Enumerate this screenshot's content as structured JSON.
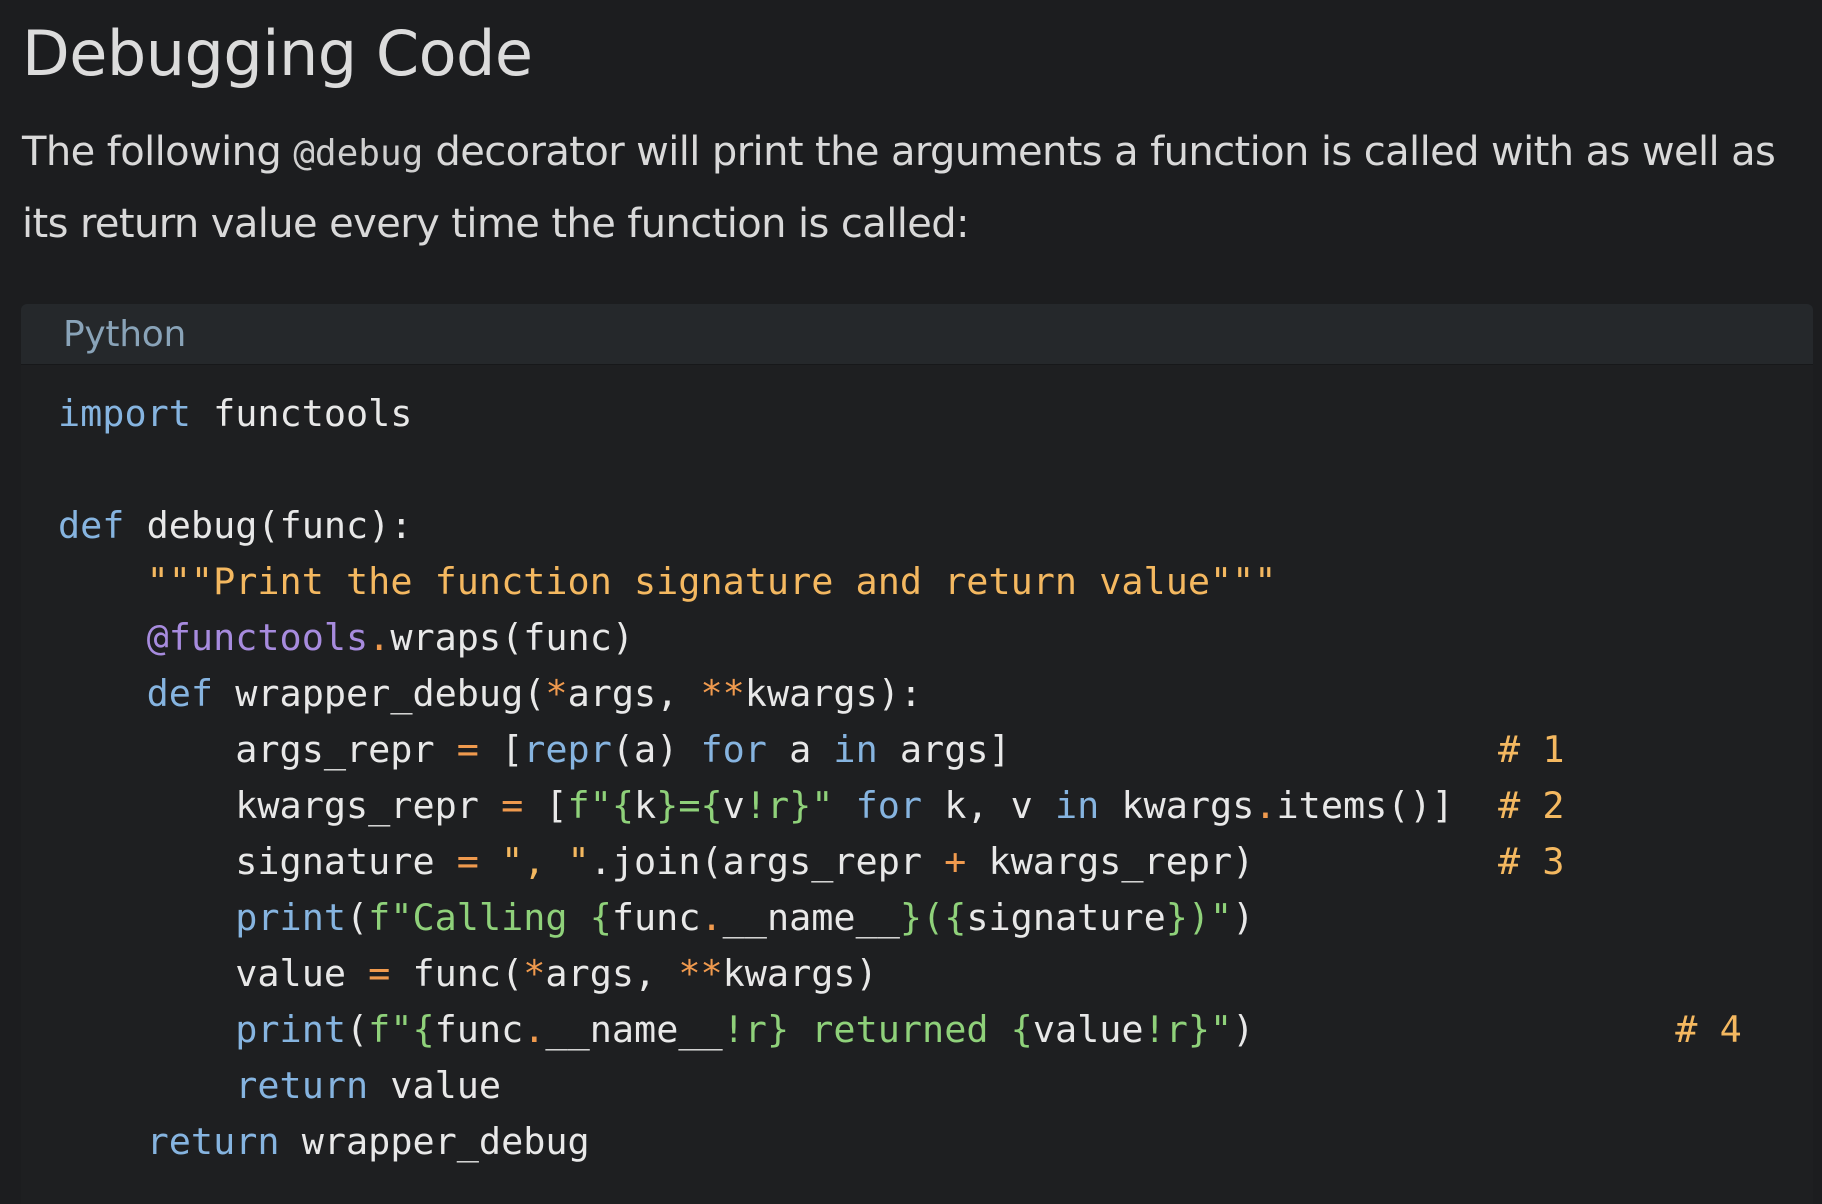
{
  "page": {
    "title": "Debugging Code",
    "intro": {
      "before": "The following ",
      "code": "@debug",
      "after": " decorator will print the arguments a function is called with as well as its return value every time the function is called:"
    }
  },
  "code_block": {
    "language": "Python",
    "lines": [
      [
        {
          "t": "import",
          "k": "kw"
        },
        {
          "t": " functools"
        }
      ],
      [],
      [
        {
          "t": "def",
          "k": "kw"
        },
        {
          "t": " debug(func):"
        }
      ],
      [
        {
          "t": "    "
        },
        {
          "t": "\"\"\"Print the function signature and return value\"\"\"",
          "k": "str"
        }
      ],
      [
        {
          "t": "    "
        },
        {
          "t": "@functools",
          "k": "dec"
        },
        {
          "t": ".",
          "k": "op"
        },
        {
          "t": "wraps(func)"
        }
      ],
      [
        {
          "t": "    "
        },
        {
          "t": "def",
          "k": "kw"
        },
        {
          "t": " wrapper_debug("
        },
        {
          "t": "*",
          "k": "op"
        },
        {
          "t": "args, "
        },
        {
          "t": "**",
          "k": "op"
        },
        {
          "t": "kwargs):"
        }
      ],
      [
        {
          "t": "        args_repr "
        },
        {
          "t": "=",
          "k": "op"
        },
        {
          "t": " ["
        },
        {
          "t": "repr",
          "k": "bi"
        },
        {
          "t": "(a) "
        },
        {
          "t": "for",
          "k": "kw"
        },
        {
          "t": " a "
        },
        {
          "t": "in",
          "k": "kw"
        },
        {
          "t": " args]                      "
        },
        {
          "t": "# 1",
          "k": "cm"
        }
      ],
      [
        {
          "t": "        kwargs_repr "
        },
        {
          "t": "=",
          "k": "op"
        },
        {
          "t": " ["
        },
        {
          "t": "f\"",
          "k": "fs"
        },
        {
          "t": "{",
          "k": "fs"
        },
        {
          "t": "k"
        },
        {
          "t": "}=",
          "k": "fs"
        },
        {
          "t": "{",
          "k": "fs"
        },
        {
          "t": "v"
        },
        {
          "t": "!r",
          "k": "fs"
        },
        {
          "t": "}\"",
          "k": "fs"
        },
        {
          "t": " "
        },
        {
          "t": "for",
          "k": "kw"
        },
        {
          "t": " k, v "
        },
        {
          "t": "in",
          "k": "kw"
        },
        {
          "t": " kwargs"
        },
        {
          "t": ".",
          "k": "op"
        },
        {
          "t": "items()]  "
        },
        {
          "t": "# 2",
          "k": "cm"
        }
      ],
      [
        {
          "t": "        signature "
        },
        {
          "t": "=",
          "k": "op"
        },
        {
          "t": " "
        },
        {
          "t": "\", \"",
          "k": "str"
        },
        {
          "t": ".join(args_repr "
        },
        {
          "t": "+",
          "k": "op"
        },
        {
          "t": " kwargs_repr)           "
        },
        {
          "t": "# 3",
          "k": "cm"
        }
      ],
      [
        {
          "t": "        "
        },
        {
          "t": "print",
          "k": "bi"
        },
        {
          "t": "("
        },
        {
          "t": "f\"Calling ",
          "k": "fs"
        },
        {
          "t": "{",
          "k": "fs"
        },
        {
          "t": "func"
        },
        {
          "t": ".",
          "k": "op"
        },
        {
          "t": "__name__"
        },
        {
          "t": "}(",
          "k": "fs"
        },
        {
          "t": "{",
          "k": "fs"
        },
        {
          "t": "signature"
        },
        {
          "t": "})\"",
          "k": "fs"
        },
        {
          "t": ")"
        }
      ],
      [
        {
          "t": "        value "
        },
        {
          "t": "=",
          "k": "op"
        },
        {
          "t": " func("
        },
        {
          "t": "*",
          "k": "op"
        },
        {
          "t": "args, "
        },
        {
          "t": "**",
          "k": "op"
        },
        {
          "t": "kwargs)"
        }
      ],
      [
        {
          "t": "        "
        },
        {
          "t": "print",
          "k": "bi"
        },
        {
          "t": "("
        },
        {
          "t": "f\"",
          "k": "fs"
        },
        {
          "t": "{",
          "k": "fs"
        },
        {
          "t": "func"
        },
        {
          "t": ".",
          "k": "op"
        },
        {
          "t": "__name__"
        },
        {
          "t": "!r} returned ",
          "k": "fs"
        },
        {
          "t": "{",
          "k": "fs"
        },
        {
          "t": "value"
        },
        {
          "t": "!r}\"",
          "k": "fs"
        },
        {
          "t": ")                   "
        },
        {
          "t": "# 4",
          "k": "cm"
        }
      ],
      [
        {
          "t": "        "
        },
        {
          "t": "return",
          "k": "kw"
        },
        {
          "t": " value"
        }
      ],
      [
        {
          "t": "    "
        },
        {
          "t": "return",
          "k": "kw"
        },
        {
          "t": " wrapper_debug"
        }
      ]
    ]
  }
}
